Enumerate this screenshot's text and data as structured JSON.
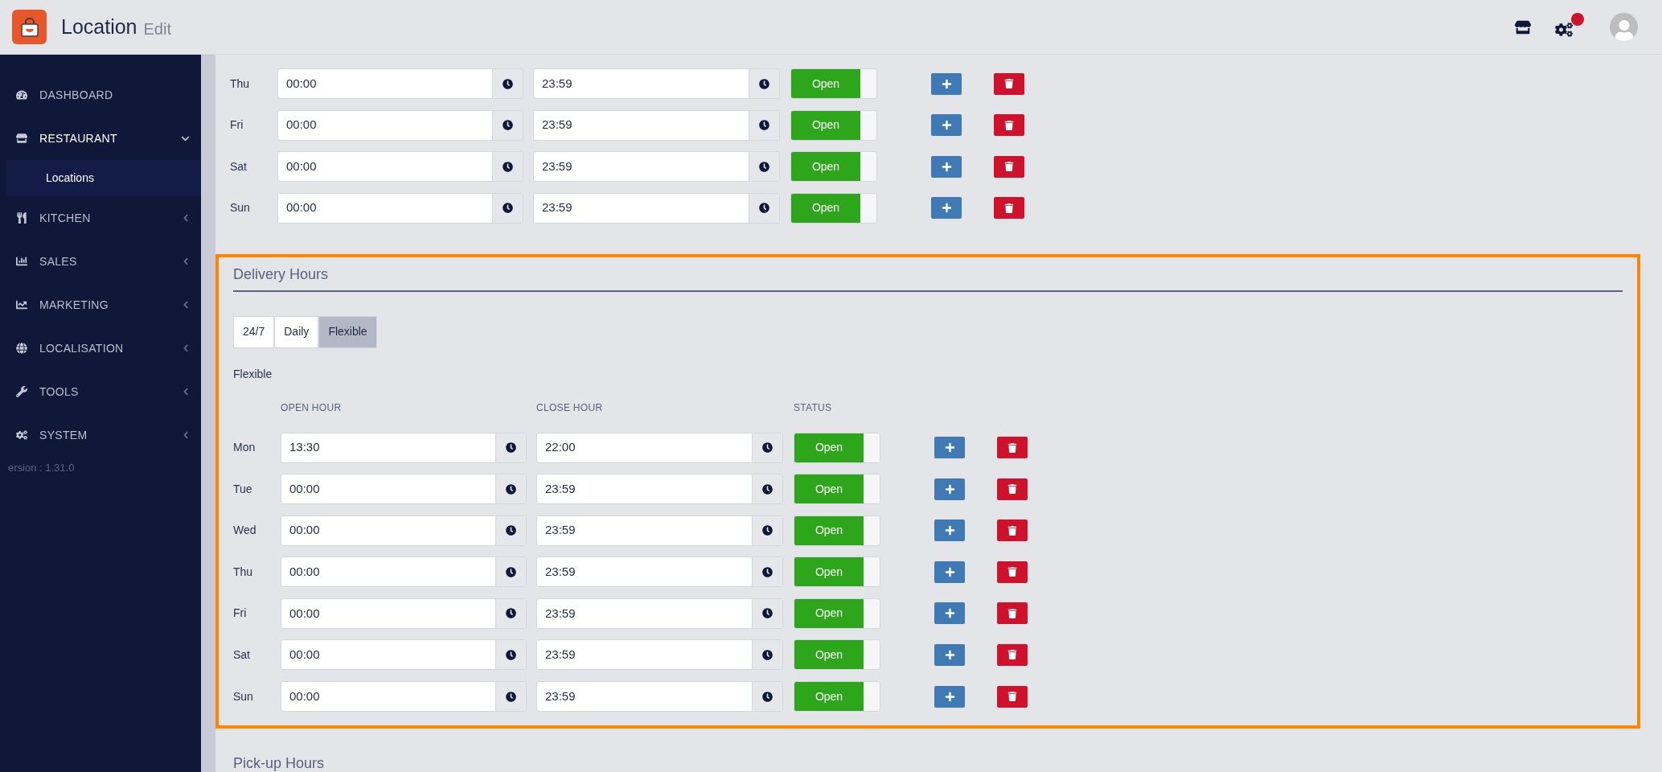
{
  "header": {
    "title": "Location",
    "subtitle": "Edit",
    "notification": true
  },
  "sidebar": {
    "items": [
      {
        "label": "DASHBOARD"
      },
      {
        "label": "RESTAURANT",
        "expanded": true,
        "children": [
          {
            "label": "Locations",
            "selected": true
          }
        ]
      },
      {
        "label": "KITCHEN",
        "expanded": false
      },
      {
        "label": "SALES",
        "expanded": false
      },
      {
        "label": "MARKETING",
        "expanded": false
      },
      {
        "label": "LOCALISATION",
        "expanded": false
      },
      {
        "label": "TOOLS",
        "expanded": false
      },
      {
        "label": "SYSTEM",
        "expanded": false
      }
    ],
    "version": "ersion : 1.31.0"
  },
  "upper_rows": [
    {
      "day": "Thu",
      "open": "00:00",
      "close": "23:59",
      "on": true,
      "status": "Open"
    },
    {
      "day": "Fri",
      "open": "00:00",
      "close": "23:59",
      "on": true,
      "status": "Open"
    },
    {
      "day": "Sat",
      "open": "00:00",
      "close": "23:59",
      "on": true,
      "status": "Open"
    },
    {
      "day": "Sun",
      "open": "00:00",
      "close": "23:59",
      "on": true,
      "status": "Open"
    }
  ],
  "delivery": {
    "title": "Delivery Hours",
    "highlighted": true,
    "tabs": [
      {
        "label": "24/7",
        "selected": false
      },
      {
        "label": "Daily",
        "selected": false
      },
      {
        "label": "Flexible",
        "selected": true
      }
    ],
    "mode_label": "Flexible",
    "columns": [
      "OPEN HOUR",
      "CLOSE HOUR",
      "STATUS"
    ],
    "rows": [
      {
        "day": "Mon",
        "open": "13:30",
        "close": "22:00",
        "on": true,
        "status": "Open"
      },
      {
        "day": "Tue",
        "open": "00:00",
        "close": "23:59",
        "on": true,
        "status": "Open"
      },
      {
        "day": "Wed",
        "open": "00:00",
        "close": "23:59",
        "on": true,
        "status": "Open"
      },
      {
        "day": "Thu",
        "open": "00:00",
        "close": "23:59",
        "on": true,
        "status": "Open"
      },
      {
        "day": "Fri",
        "open": "00:00",
        "close": "23:59",
        "on": true,
        "status": "Open"
      },
      {
        "day": "Sat",
        "open": "00:00",
        "close": "23:59",
        "on": true,
        "status": "Open"
      },
      {
        "day": "Sun",
        "open": "00:00",
        "close": "23:59",
        "on": true,
        "status": "Open"
      }
    ]
  },
  "pickup": {
    "title": "Pick-up Hours"
  }
}
